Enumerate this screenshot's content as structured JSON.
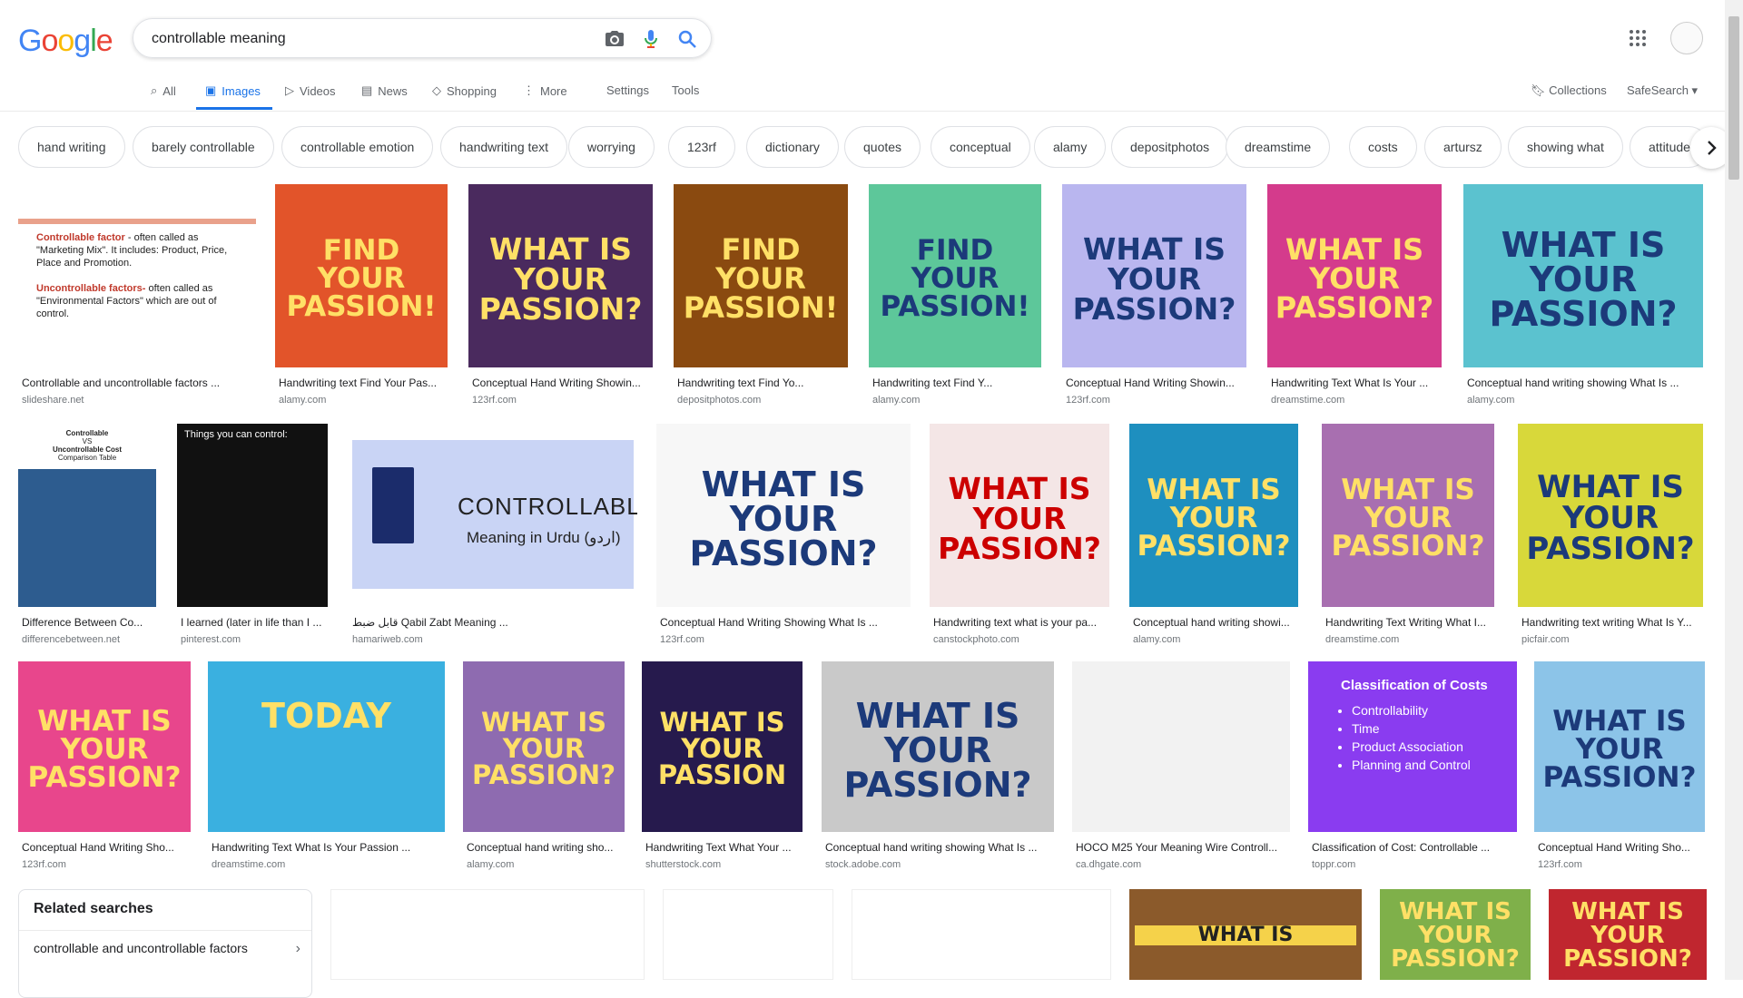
{
  "header": {
    "logo_letters": [
      "G",
      "o",
      "o",
      "g",
      "l",
      "e"
    ],
    "logo_colors": [
      "#4285F4",
      "#EA4335",
      "#FBBC05",
      "#4285F4",
      "#34A853",
      "#EA4335"
    ],
    "query": "controllable meaning"
  },
  "tabs": [
    {
      "label": "All",
      "icon": "search-icon"
    },
    {
      "label": "Images",
      "icon": "image-icon",
      "active": true
    },
    {
      "label": "Videos",
      "icon": "play-icon"
    },
    {
      "label": "News",
      "icon": "news-icon"
    },
    {
      "label": "Shopping",
      "icon": "tag-icon"
    },
    {
      "label": "More",
      "icon": "more-vert-icon"
    },
    {
      "label": "Settings"
    },
    {
      "label": "Tools"
    }
  ],
  "right_links": {
    "collections": "Collections",
    "safesearch": "SafeSearch ▾"
  },
  "chips": [
    "hand writing",
    "barely controllable",
    "controllable emotion",
    "handwriting text",
    "worrying",
    "123rf",
    "dictionary",
    "quotes",
    "conceptual",
    "alamy",
    "depositphotos",
    "dreamstime",
    "costs",
    "artursz",
    "showing what",
    "attitude"
  ],
  "results": [
    {
      "title": "Controllable and uncontrollable factors ...",
      "source": "slideshare.net",
      "bg": "#ffffff",
      "text": ""
    },
    {
      "title": "Handwriting text Find Your Pas...",
      "source": "alamy.com",
      "bg": "#e2542a",
      "text": "FIND YOUR PASSION!"
    },
    {
      "title": "Conceptual Hand Writing Showin...",
      "source": "123rf.com",
      "bg": "#4a2a5e",
      "text": "WHAT IS YOUR PASSION?"
    },
    {
      "title": "Handwriting text Find Yo...",
      "source": "depositphotos.com",
      "bg": "#8a4a10",
      "text": "FIND YOUR PASSION!"
    },
    {
      "title": "Handwriting text Find Y...",
      "source": "alamy.com",
      "bg": "#5dc79a",
      "text": "FIND YOUR PASSION!"
    },
    {
      "title": "Conceptual Hand Writing Showin...",
      "source": "123rf.com",
      "bg": "#b9b6ef",
      "text": "WHAT IS YOUR PASSION?"
    },
    {
      "title": "Handwriting Text What Is Your ...",
      "source": "dreamstime.com",
      "bg": "#d43b8c",
      "text": "WHAT IS YOUR PASSION?"
    },
    {
      "title": "Conceptual hand writing showing What Is ...",
      "source": "alamy.com",
      "bg": "#5bc2cf",
      "text": "WHAT IS YOUR PASSION?"
    },
    {
      "title": "Difference Between Co...",
      "source": "differencebetween.net",
      "bg": "#2d5c8f",
      "text": ""
    },
    {
      "title": "I learned (later in life than I ...",
      "source": "pinterest.com",
      "bg": "#111111",
      "text": ""
    },
    {
      "title": "قابل ضبط Qabil Zabt Meaning ...",
      "source": "hamariweb.com",
      "bg": "#c9d4f5",
      "text": ""
    },
    {
      "title": "Conceptual Hand Writing Showing What Is ...",
      "source": "123rf.com",
      "bg": "#f7f7f7",
      "text": "WHAT IS YOUR PASSION?"
    },
    {
      "title": "Handwriting text what is your pa...",
      "source": "canstockphoto.com",
      "bg": "#f4e6e6",
      "text": "WHAT IS YOUR PASSION?"
    },
    {
      "title": "Conceptual hand writing showi...",
      "source": "alamy.com",
      "bg": "#1e8fbf",
      "text": "WHAT IS YOUR PASSION?"
    },
    {
      "title": "Handwriting Text Writing What I...",
      "source": "dreamstime.com",
      "bg": "#a86fb0",
      "text": "WHAT IS YOUR PASSION?"
    },
    {
      "title": "Handwriting text writing What Is Y...",
      "source": "picfair.com",
      "bg": "#d8d83a",
      "text": "WHAT IS YOUR PASSION?"
    },
    {
      "title": "Conceptual Hand Writing Sho...",
      "source": "123rf.com",
      "bg": "#e8468c",
      "text": "WHAT IS YOUR PASSION?"
    },
    {
      "title": "Handwriting Text What Is Your Passion ...",
      "source": "dreamstime.com",
      "bg": "#3ab0e0",
      "text": "TODAY"
    },
    {
      "title": "Conceptual hand writing sho...",
      "source": "alamy.com",
      "bg": "#8e6bb0",
      "text": "WHAT IS YOUR PASSION?"
    },
    {
      "title": "Handwriting Text What Your ...",
      "source": "shutterstock.com",
      "bg": "#261a4d",
      "text": "WHAT IS YOUR PASSION"
    },
    {
      "title": "Conceptual hand writing showing What Is ...",
      "source": "stock.adobe.com",
      "bg": "#c9c9c9",
      "text": "WHAT IS YOUR PASSION?"
    },
    {
      "title": "HOCO M25 Your Meaning Wire Controll...",
      "source": "ca.dhgate.com",
      "bg": "#f2f2f2",
      "text": ""
    },
    {
      "title": "Classification of Cost: Controllable ...",
      "source": "toppr.com",
      "bg": "#8a3cf0",
      "text": ""
    },
    {
      "title": "Conceptual Hand Writing Sho...",
      "source": "123rf.com",
      "bg": "#8cc4e8",
      "text": "WHAT IS YOUR PASSION?"
    }
  ],
  "slideshare_lines": {
    "a": "Controllable factor",
    "b": " - often called as \"Marketing Mix\". It includes: Product, Price, Place and Promotion.",
    "c": "Uncontrollable factors-",
    "d": " often called as \"Environmental Factors\" which are out of control."
  },
  "diff_lines": {
    "a": "Controllable",
    "b": "VS",
    "c": "Uncontrollable Cost",
    "d": "Comparison Table"
  },
  "hamari": {
    "a": "CONTROLLABLE",
    "b": "Meaning in Urdu (اردو)"
  },
  "toppr": {
    "title": "Classification of Costs",
    "items": [
      "Controllability",
      "Time",
      "Product Association",
      "Planning and Control"
    ]
  },
  "pinterest_head": "Things you can control:",
  "related": {
    "heading": "Related searches",
    "item": "controllable and uncontrollable factors"
  },
  "bottom_row_bg": [
    "#ffffff",
    "#ffffff",
    "#ffffff",
    "#8b5a2b",
    "#7fb04a",
    "#c0262f"
  ],
  "bottom_row_text": [
    "",
    "",
    "",
    "WHAT IS",
    "WHAT IS YOUR PASSION?",
    "WHAT IS YOUR PASSION?"
  ]
}
